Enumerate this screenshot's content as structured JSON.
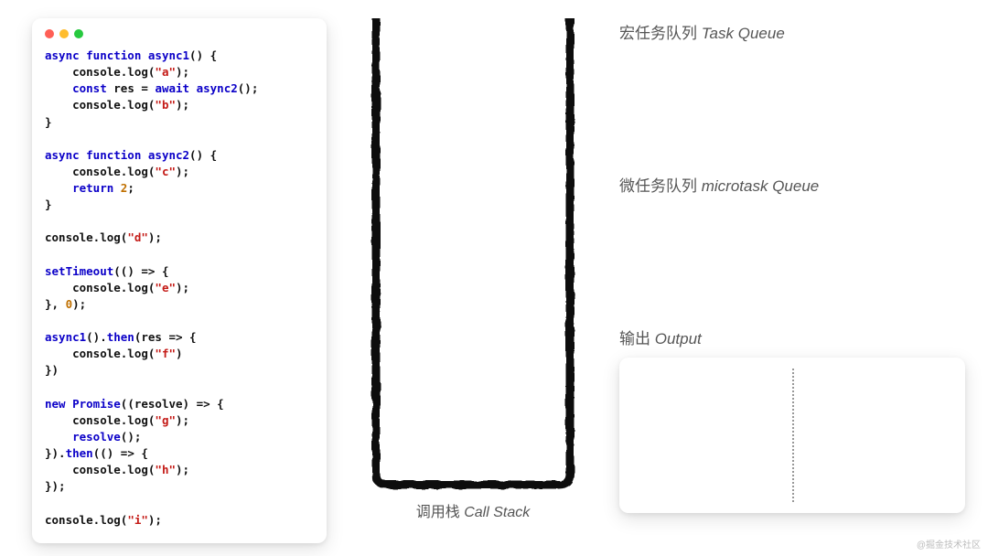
{
  "code": {
    "lines": [
      [
        [
          "kw",
          "async function "
        ],
        [
          "fn",
          "async1"
        ],
        [
          "pl",
          "() {"
        ]
      ],
      [
        [
          "pl",
          "    console.log("
        ],
        [
          "str",
          "\"a\""
        ],
        [
          "pl",
          ");"
        ]
      ],
      [
        [
          "pl",
          "    "
        ],
        [
          "kw",
          "const"
        ],
        [
          "pl",
          " res = "
        ],
        [
          "kw",
          "await"
        ],
        [
          "pl",
          " "
        ],
        [
          "fn",
          "async2"
        ],
        [
          "pl",
          "();"
        ]
      ],
      [
        [
          "pl",
          "    console.log("
        ],
        [
          "str",
          "\"b\""
        ],
        [
          "pl",
          ");"
        ]
      ],
      [
        [
          "pl",
          "}"
        ]
      ],
      [
        [
          "pl",
          ""
        ]
      ],
      [
        [
          "kw",
          "async function "
        ],
        [
          "fn",
          "async2"
        ],
        [
          "pl",
          "() {"
        ]
      ],
      [
        [
          "pl",
          "    console.log("
        ],
        [
          "str",
          "\"c\""
        ],
        [
          "pl",
          ");"
        ]
      ],
      [
        [
          "pl",
          "    "
        ],
        [
          "kw",
          "return"
        ],
        [
          "pl",
          " "
        ],
        [
          "num",
          "2"
        ],
        [
          "pl",
          ";"
        ]
      ],
      [
        [
          "pl",
          "}"
        ]
      ],
      [
        [
          "pl",
          ""
        ]
      ],
      [
        [
          "pl",
          "console.log("
        ],
        [
          "str",
          "\"d\""
        ],
        [
          "pl",
          ");"
        ]
      ],
      [
        [
          "pl",
          ""
        ]
      ],
      [
        [
          "fn",
          "setTimeout"
        ],
        [
          "pl",
          "(() => {"
        ]
      ],
      [
        [
          "pl",
          "    console.log("
        ],
        [
          "str",
          "\"e\""
        ],
        [
          "pl",
          ");"
        ]
      ],
      [
        [
          "pl",
          "}, "
        ],
        [
          "num",
          "0"
        ],
        [
          "pl",
          ");"
        ]
      ],
      [
        [
          "pl",
          ""
        ]
      ],
      [
        [
          "fn",
          "async1"
        ],
        [
          "pl",
          "()."
        ],
        [
          "fn",
          "then"
        ],
        [
          "pl",
          "(res => {"
        ]
      ],
      [
        [
          "pl",
          "    console.log("
        ],
        [
          "str",
          "\"f\""
        ],
        [
          "pl",
          ")"
        ]
      ],
      [
        [
          "pl",
          "})"
        ]
      ],
      [
        [
          "pl",
          ""
        ]
      ],
      [
        [
          "kw",
          "new"
        ],
        [
          "pl",
          " "
        ],
        [
          "fn",
          "Promise"
        ],
        [
          "pl",
          "((resolve) => {"
        ]
      ],
      [
        [
          "pl",
          "    console.log("
        ],
        [
          "str",
          "\"g\""
        ],
        [
          "pl",
          ");"
        ]
      ],
      [
        [
          "pl",
          "    "
        ],
        [
          "fn",
          "resolve"
        ],
        [
          "pl",
          "();"
        ]
      ],
      [
        [
          "pl",
          "})."
        ],
        [
          "fn",
          "then"
        ],
        [
          "pl",
          "(() => {"
        ]
      ],
      [
        [
          "pl",
          "    console.log("
        ],
        [
          "str",
          "\"h\""
        ],
        [
          "pl",
          ");"
        ]
      ],
      [
        [
          "pl",
          "});"
        ]
      ],
      [
        [
          "pl",
          ""
        ]
      ],
      [
        [
          "pl",
          "console.log("
        ],
        [
          "str",
          "\"i\""
        ],
        [
          "pl",
          ");"
        ]
      ]
    ]
  },
  "labels": {
    "callStack_cn": "调用栈",
    "callStack_en": "Call Stack",
    "taskQueue_cn": "宏任务队列",
    "taskQueue_en": "Task Queue",
    "microQueue_cn": "微任务队列",
    "microQueue_en": "microtask Queue",
    "output_cn": "输出",
    "output_en": "Output"
  },
  "watermark": "@掘金技术社区"
}
